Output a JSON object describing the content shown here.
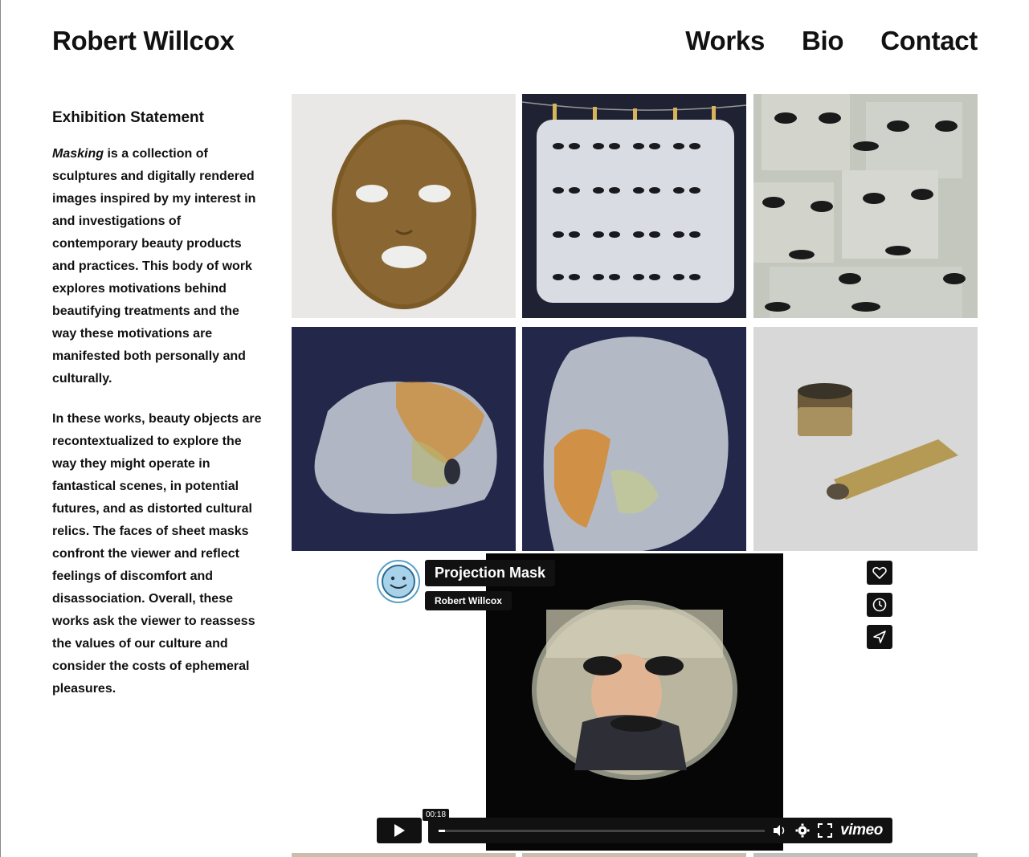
{
  "site": {
    "title": "Robert Willcox",
    "nav": [
      "Works",
      "Bio",
      "Contact"
    ]
  },
  "statement": {
    "heading": "Exhibition Statement",
    "lead_italic": "Masking",
    "p1_rest": " is a collection of sculptures and digitally rendered images inspired by my interest in and investigations of contemporary beauty products and practices. This body of work explores motivations behind beautifying treatments and the way these motivations are manifested both personally and culturally.",
    "p2": "In these works, beauty objects are recontextualized to explore the way they might operate in fantastical scenes, in potential futures, and as distorted cultural relics. The faces of sheet masks confront the viewer and reflect feelings of discomfort and disassociation. Overall, these works ask the viewer to reassess the values of our culture and consider the costs of ephemeral pleasures."
  },
  "gallery": {
    "items": [
      {
        "name": "gallery-image-1",
        "subject": "brown sheet mask on white"
      },
      {
        "name": "gallery-image-2",
        "subject": "white masks on clothesline"
      },
      {
        "name": "gallery-image-3",
        "subject": "grid of paper masks"
      },
      {
        "name": "gallery-image-4",
        "subject": "translucent plastic mask"
      },
      {
        "name": "gallery-image-5",
        "subject": "plastic wrapped head"
      },
      {
        "name": "gallery-image-6",
        "subject": "gold jar and tube"
      }
    ]
  },
  "video": {
    "title": "Projection Mask",
    "byline": "Robert Willcox",
    "time": "00:18",
    "progress": 0.02,
    "logo": "vimeo",
    "side_icons": [
      "heart-icon",
      "clock-icon",
      "send-icon"
    ],
    "control_icons": [
      "play-icon",
      "volume-icon",
      "settings-icon",
      "fullscreen-icon"
    ]
  },
  "colors": {
    "text": "#111111",
    "player_bg": "#111111",
    "avatar_ring": "#5aa0c8",
    "gallery_backdrop": "#23284a"
  }
}
